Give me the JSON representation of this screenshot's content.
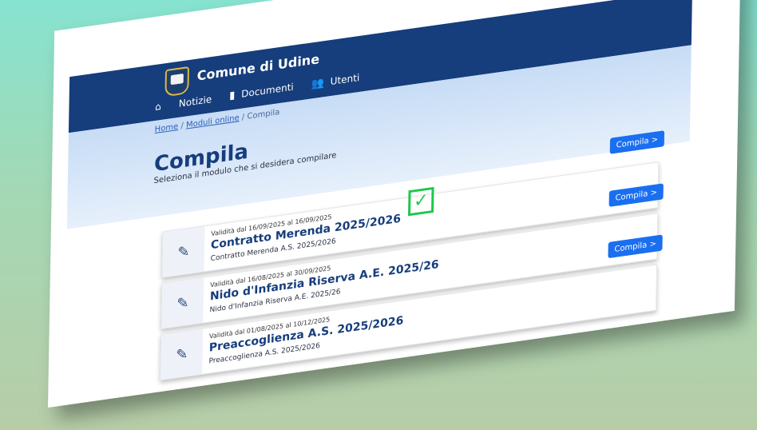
{
  "header": {
    "title": "Comune di Udine",
    "nav": {
      "home_icon": "home-icon",
      "notizie": "Notizie",
      "documenti": "Documenti",
      "utenti": "Utenti",
      "documenti_icon": "document-icon",
      "utenti_icon": "users-icon"
    }
  },
  "breadcrumb": {
    "home": "Home",
    "sep": "/",
    "moduli": "Moduli online",
    "current": "Compila"
  },
  "page": {
    "title": "Compila",
    "subtitle": "Seleziona il modulo che si desidera compilare"
  },
  "cards": [
    {
      "validity": "Validità dal 16/09/2025 al 16/09/2025",
      "title": "Contratto Merenda 2025/2026",
      "description": "Contratto Merenda A.S. 2025/2026",
      "button": "Compila >"
    },
    {
      "validity": "Validità dal 16/08/2025 al 30/09/2025",
      "title": "Nido d'Infanzia Riserva A.E. 2025/26",
      "description": "Nido d'Infanzia Riserva A.E. 2025/26",
      "button": "Compila >"
    },
    {
      "validity": "Validità dal 01/08/2025 al 10/12/2025",
      "title": "Preaccoglienza A.S. 2025/2026",
      "description": "Preaccoglienza A.S. 2025/2026",
      "button": "Compila >"
    }
  ],
  "check_overlay": "✓",
  "colors": {
    "header_bg": "#163d7c",
    "accent": "#1a6ff0",
    "check": "#1cc84a"
  }
}
